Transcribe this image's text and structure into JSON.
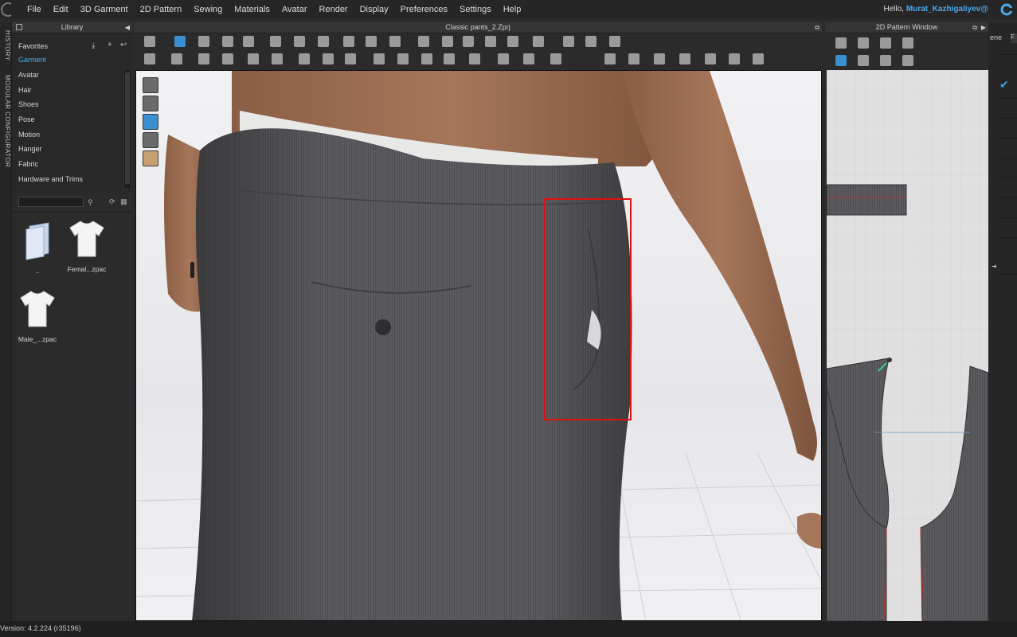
{
  "menu": {
    "items": [
      "File",
      "Edit",
      "3D Garment",
      "2D Pattern",
      "Sewing",
      "Materials",
      "Avatar",
      "Render",
      "Display",
      "Preferences",
      "Settings",
      "Help"
    ],
    "greeting_prefix": "Hello,",
    "user": "Murat_Kazhigaliyev@"
  },
  "vertical_tabs": [
    "HISTORY",
    "MODULAR CONFIGURATOR"
  ],
  "library": {
    "title": "Library",
    "items": [
      "Favorites",
      "Garment",
      "Avatar",
      "Hair",
      "Shoes",
      "Pose",
      "Motion",
      "Hanger",
      "Fabric",
      "Hardware and Trims"
    ],
    "active_item": "Garment",
    "thumbnails": [
      {
        "label": "..",
        "icon": "folder-icon"
      },
      {
        "label": "Femal...zpac",
        "icon": "tshirt-icon"
      },
      {
        "label": "Male_...zpac",
        "icon": "tshirt-icon"
      }
    ]
  },
  "viewport": {
    "title": "Classic pants_2.Zprj"
  },
  "pattern_window": {
    "title": "2D Pattern Window"
  },
  "right_strip": {
    "tab_label": "ene",
    "tab_label2": "F"
  },
  "status": {
    "version": "Version: 4.2.224 (r35196)"
  },
  "colors": {
    "accent": "#4aa8e8",
    "highlight_box": "#e01010",
    "fabric": "#5a5a5e"
  }
}
